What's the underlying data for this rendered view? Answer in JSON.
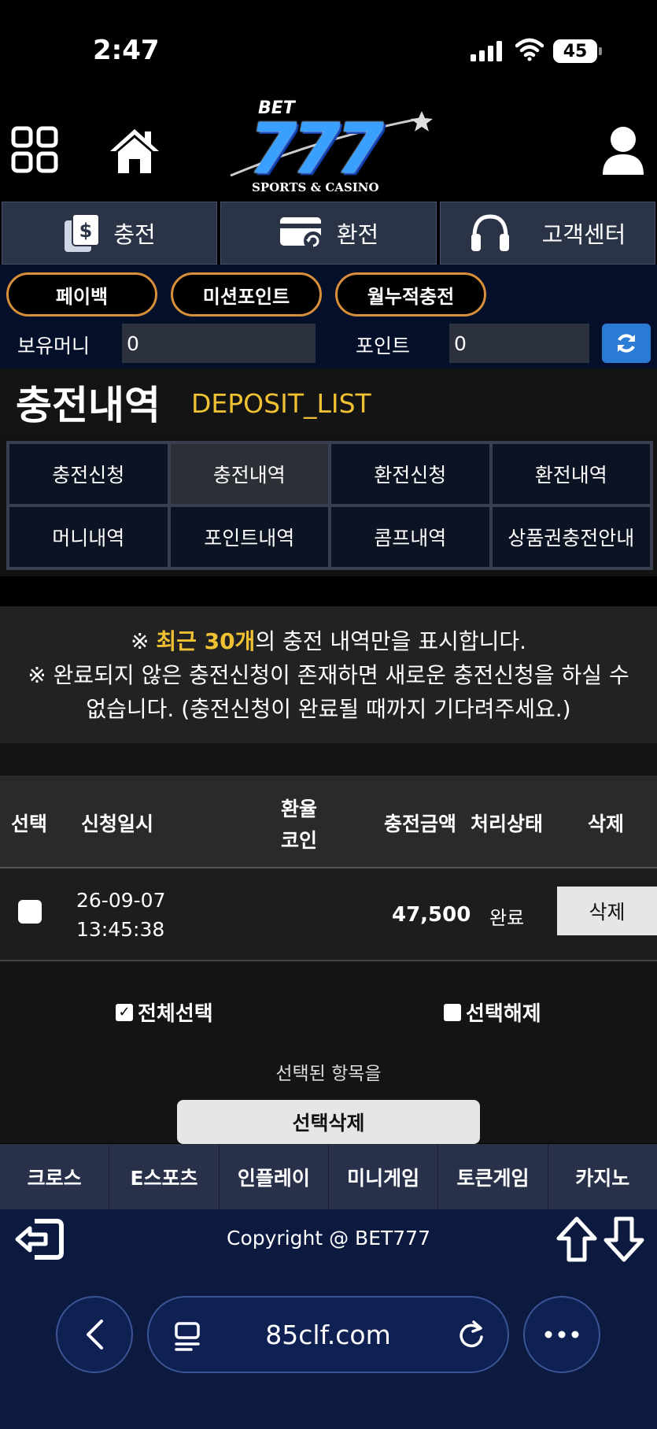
{
  "status_bar": {
    "time": "2:47",
    "battery": "45"
  },
  "header": {
    "logo_top": "BET",
    "logo_main": "777",
    "logo_sub": "SPORTS & CASINO"
  },
  "top_nav": [
    {
      "label": "충전",
      "icon": "deposit-icon"
    },
    {
      "label": "환전",
      "icon": "withdraw-icon"
    },
    {
      "label": "고객센터",
      "icon": "headset-icon"
    }
  ],
  "sub_nav": [
    "페이백",
    "미션포인트",
    "월누적충전"
  ],
  "balance": {
    "money_label": "보유머니",
    "money_value": "0",
    "point_label": "포인트",
    "point_value": "0"
  },
  "page": {
    "title": "충전내역",
    "subtitle": "DEPOSIT_LIST"
  },
  "tabs": [
    "충전신청",
    "충전내역",
    "환전신청",
    "환전내역",
    "머니내역",
    "포인트내역",
    "콤프내역",
    "상품권충전안내"
  ],
  "active_tab": "충전내역",
  "notice": {
    "line1_prefix": "※ ",
    "line1_highlight": "최근 30개",
    "line1_suffix": "의 충전 내역만을 표시합니다.",
    "line2": "※ 완료되지 않은 충전신청이 존재하면 새로운 충전신청을 하실 수",
    "line3": "없습니다. (충전신청이 완료될 때까지 기다려주세요.)"
  },
  "table": {
    "headers": {
      "select": "선택",
      "date": "신청일시",
      "rate_line1": "환율",
      "rate_line2": "코인",
      "amount": "충전금액",
      "status": "처리상태",
      "delete": "삭제"
    },
    "rows": [
      {
        "date": "26-09-07",
        "time": "13:45:38",
        "amount": "47,500",
        "status": "완료",
        "delete_label": "삭제"
      }
    ]
  },
  "bulk": {
    "select_all": "전체선택",
    "deselect": "선택해제",
    "selected_label": "선택된 항목을",
    "delete_selected": "선택삭제"
  },
  "game_nav": [
    "크로스",
    "E스포츠",
    "인플레이",
    "미니게임",
    "토큰게임",
    "카지노"
  ],
  "footer": {
    "copyright": "Copyright @ BET777"
  },
  "browser": {
    "url": "85clf.com"
  },
  "colors": {
    "accent_orange": "#d88f3a",
    "accent_yellow": "#f0c132",
    "nav_bg": "#2b3447",
    "refresh_blue": "#2b7bd6"
  }
}
